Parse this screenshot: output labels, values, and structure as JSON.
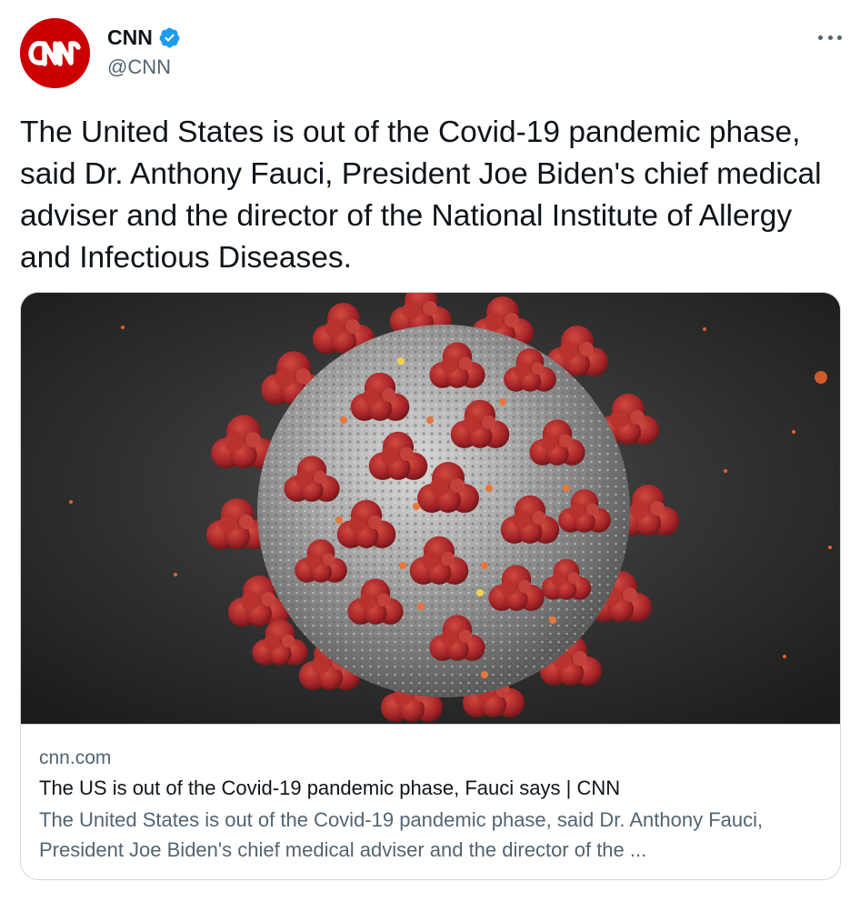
{
  "author": {
    "display_name": "CNN",
    "handle": "@CNN",
    "verified": true,
    "avatar_logo_text": "CNN",
    "avatar_color": "#cc0000"
  },
  "tweet": {
    "text": "The United States is out of the Covid-19 pandemic phase, said Dr. Anthony Fauci, President Joe Biden's chief medical adviser and the director of the National Institute of Allergy and Infectious Diseases."
  },
  "card": {
    "domain": "cnn.com",
    "title": "The US is out of the Covid-19 pandemic phase, Fauci says | CNN",
    "description": "The United States is out of the Covid-19 pandemic phase, said Dr. Anthony Fauci, President Joe Biden's chief medical adviser and the director of the ...",
    "image_subject": "coronavirus-illustration"
  },
  "icons": {
    "verified": "verified-badge-icon",
    "more": "more-options-icon"
  },
  "colors": {
    "verified_blue": "#1d9bf0",
    "secondary_text": "#536471",
    "primary_text": "#0f1419",
    "border": "#cfd9de",
    "virus_spike": "#a8262a",
    "virus_body": "#9c9c9c"
  }
}
